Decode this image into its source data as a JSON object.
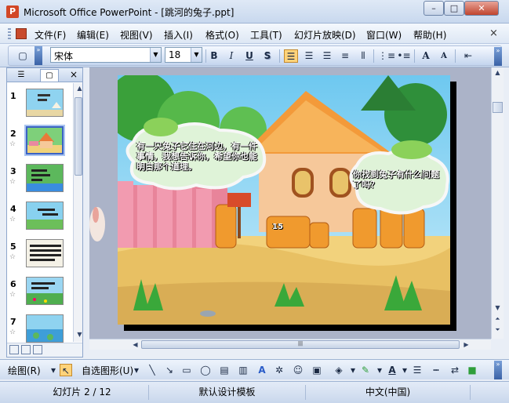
{
  "window": {
    "title": "Microsoft Office PowerPoint - [跳河的兔子.ppt]",
    "app_icon": "P",
    "minimize": "–",
    "maximize": "□",
    "close": "✕"
  },
  "menu": {
    "items": [
      "文件(F)",
      "编辑(E)",
      "视图(V)",
      "插入(I)",
      "格式(O)",
      "工具(T)",
      "幻灯片放映(D)",
      "窗口(W)",
      "帮助(H)"
    ],
    "close_doc": "×"
  },
  "toolbar": {
    "font_name": "宋体",
    "font_size": "18",
    "bold": "B",
    "italic": "I",
    "underline": "U",
    "shadow": "S",
    "grow_font": "A",
    "shrink_font": "A"
  },
  "slide_pane": {
    "close": "×",
    "slides": [
      {
        "number": "1"
      },
      {
        "number": "2",
        "current": true
      },
      {
        "number": "3"
      },
      {
        "number": "4"
      },
      {
        "number": "5"
      },
      {
        "number": "6"
      },
      {
        "number": "7"
      }
    ]
  },
  "slide": {
    "bubble_left": "有一只兔子它住在河边，有一件事情，我想告诉你，希望你也能明白那个道理。",
    "bubble_right": "你找到兔子有什么问题了吗？",
    "door_number": "15"
  },
  "drawing_toolbar": {
    "draw_menu": "绘图(R)",
    "autoshapes": "自选图形(U)"
  },
  "status": {
    "slide_position": "幻灯片 2 / 12",
    "design_template": "默认设计模板",
    "language": "中文(中国)"
  },
  "colors": {
    "accent": "#3b63c4",
    "highlight_button": "#ffd37a",
    "close_button": "#c0452f"
  }
}
